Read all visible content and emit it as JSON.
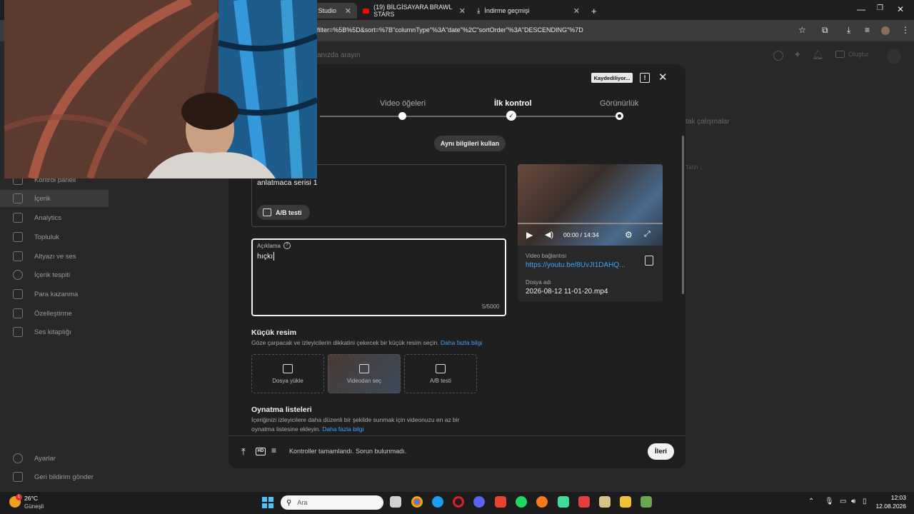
{
  "browser": {
    "tabs": [
      {
        "label": "e Studio"
      },
      {
        "label": "(19) BİLGİSAYARA BRAWL STARS"
      },
      {
        "label": "İndirme geçmişi"
      }
    ],
    "new_tab": "+",
    "url": "filter=%5B%5D&sort=%7B\"columnType\"%3A\"date\"%2C\"sortOrder\"%3A\"DESCENDING\"%7D"
  },
  "studio_header": {
    "search_placeholder": "anızda arayın",
    "create_label": "Oluştur"
  },
  "sidebar": {
    "items": [
      {
        "label": "Kontrol paneli",
        "icon": "dashboard-icon"
      },
      {
        "label": "İçerik",
        "icon": "content-icon"
      },
      {
        "label": "Analytics",
        "icon": "analytics-icon"
      },
      {
        "label": "Topluluk",
        "icon": "community-icon"
      },
      {
        "label": "Altyazı ve ses",
        "icon": "subtitles-icon"
      },
      {
        "label": "İçerik tespiti",
        "icon": "copyright-icon"
      },
      {
        "label": "Para kazanma",
        "icon": "monetization-icon"
      },
      {
        "label": "Özelleştirme",
        "icon": "customization-icon"
      },
      {
        "label": "Ses kitaplığı",
        "icon": "audio-library-icon"
      }
    ],
    "settings": "Ayarlar",
    "feedback": "Geri bildirim gönder"
  },
  "background": {
    "tab_hint": "tak çalışmalar",
    "col_date": "Tarih ↓"
  },
  "modal": {
    "saving_badge": "Kaydediliyor...",
    "steps": [
      {
        "label": "Video öğeleri"
      },
      {
        "label": "İlk kontrol"
      },
      {
        "label": "Görünürlük"
      }
    ],
    "same_info_button": "Aynı bilgileri kullan",
    "title_value": "anlatmaca serisi 1",
    "ab_test_label": "A/B testi",
    "description_label": "Açıklama",
    "description_value": "hıçkı",
    "description_counter": "5/5000",
    "video": {
      "time": "00:00 / 14:34",
      "link_label": "Video bağlantısı",
      "link_value": "https://youtu.be/8UvJI1DAHQ...",
      "filename_label": "Dosya adı",
      "filename_value": "2026-08-12 11-01-20.mp4"
    },
    "thumbnail": {
      "heading": "Küçük resim",
      "desc": "Göze çarpacak ve izleyicilerin dikkatini çekecek bir küçük resim seçin.",
      "more": "Daha fazla bilgi",
      "options": [
        {
          "label": "Dosya yükle",
          "icon": "upload-image-icon"
        },
        {
          "label": "Videodan seç",
          "icon": "video-frame-icon"
        },
        {
          "label": "A/B testi",
          "icon": "ab-test-icon"
        }
      ]
    },
    "playlists": {
      "heading": "Oynatma listeleri",
      "desc1": "İçeriğinizi izleyicilere daha düzenli bir şekilde sunmak için videonuzu en az bir",
      "desc2": "oynatma listesine ekleyin.",
      "more": "Daha fazla bilgi"
    },
    "footer_status": "Kontroller tamamlandı. Sorun bulunmadı.",
    "next_button": "İleri"
  },
  "taskbar": {
    "weather_temp": "26°C",
    "weather_desc": "Güneşli",
    "weather_badge": "1",
    "search_placeholder": "Ara",
    "time": "12:03",
    "date": "12.08.2026"
  }
}
